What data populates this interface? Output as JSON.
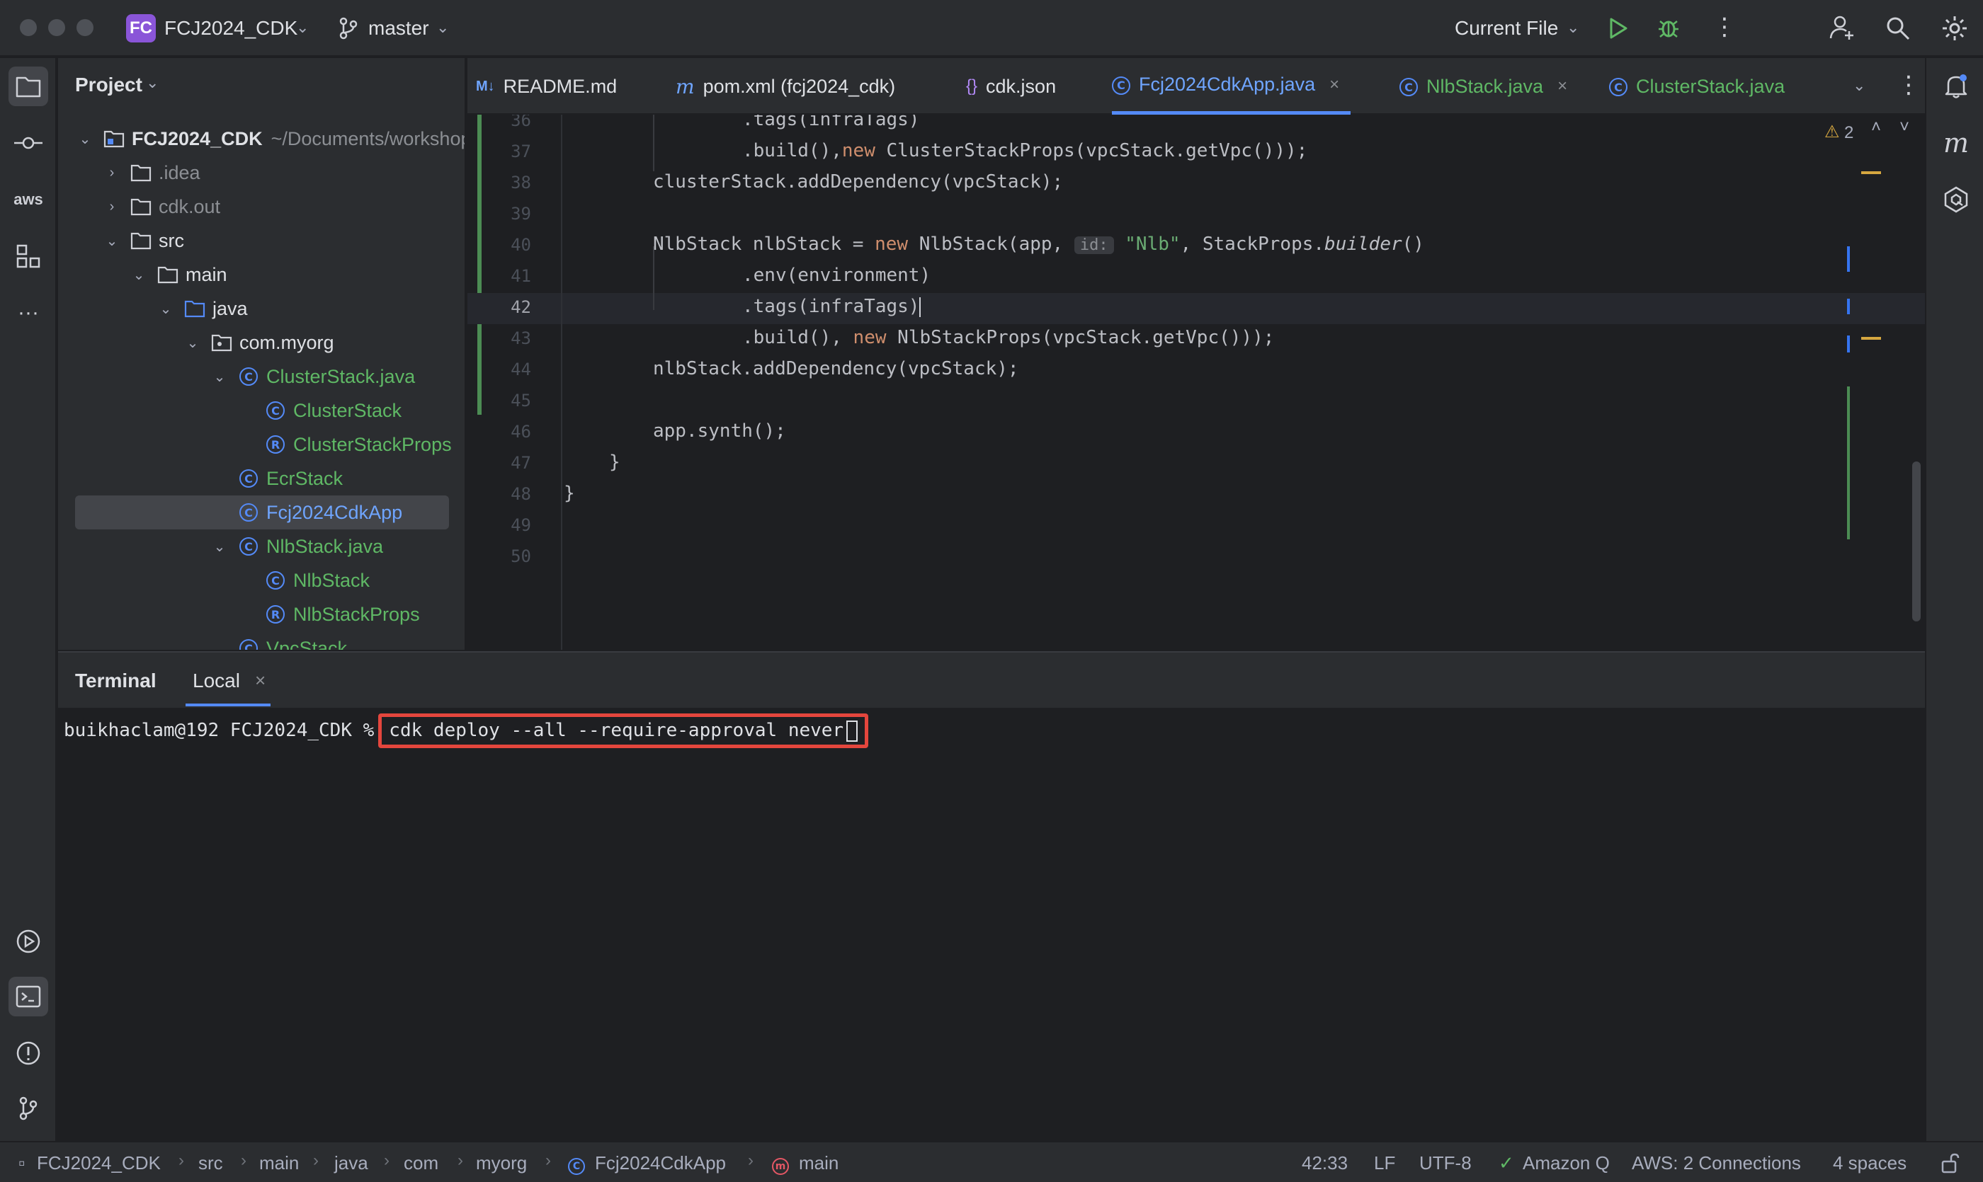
{
  "titlebar": {
    "project_badge": "FC",
    "project_name": "FCJ2024_CDK",
    "branch": "master",
    "run_config": "Current File"
  },
  "project_panel": {
    "title": "Project",
    "tree": [
      {
        "label": "FCJ2024_CDK",
        "suffix": "~/Documents/workshop"
      },
      {
        "label": ".idea"
      },
      {
        "label": "cdk.out"
      },
      {
        "label": "src"
      },
      {
        "label": "main"
      },
      {
        "label": "java"
      },
      {
        "label": "com.myorg"
      },
      {
        "label": "ClusterStack.java"
      },
      {
        "label": "ClusterStack"
      },
      {
        "label": "ClusterStackProps"
      },
      {
        "label": "EcrStack"
      },
      {
        "label": "Fcj2024CdkApp"
      },
      {
        "label": "NlbStack.java"
      },
      {
        "label": "NlbStack"
      },
      {
        "label": "NlbStackProps"
      },
      {
        "label": "VpcStack"
      }
    ]
  },
  "tabs": [
    {
      "label": "README.md",
      "icon": "M↓"
    },
    {
      "label": "pom.xml (fcj2024_cdk)",
      "icon": "m"
    },
    {
      "label": "cdk.json",
      "icon": "{}"
    },
    {
      "label": "Fcj2024CdkApp.java",
      "icon": "C",
      "active": true
    },
    {
      "label": "NlbStack.java",
      "icon": "C"
    },
    {
      "label": "ClusterStack.java",
      "icon": "C"
    }
  ],
  "editor": {
    "warning_count": "2",
    "line_numbers": [
      "36",
      "37",
      "38",
      "39",
      "40",
      "41",
      "42",
      "43",
      "44",
      "45",
      "46",
      "47",
      "48",
      "49",
      "50"
    ],
    "lines": {
      "l36": ".tags(infraTags)",
      "l37a": ".build(),",
      "l37b": "new",
      "l37c": " ClusterStackProps(vpcStack.getVpc()));",
      "l38": "clusterStack.addDependency(vpcStack);",
      "l40a": "NlbStack nlbStack = ",
      "l40b": "new",
      "l40c": " NlbStack(app, ",
      "l40hint": "id:",
      "l40str": "\"Nlb\"",
      "l40d": ", StackProps.",
      "l40e": "builder",
      "l40f": "()",
      "l41": ".env(environment)",
      "l42": ".tags(infraTags)",
      "l43a": ".build(), ",
      "l43b": "new",
      "l43c": " NlbStackProps(vpcStack.getVpc()));",
      "l44": "nlbStack.addDependency(vpcStack);",
      "l46": "app.synth();",
      "l47": "}",
      "l48": "}"
    }
  },
  "terminal": {
    "title": "Terminal",
    "tab": "Local",
    "prompt": "buikhaclam@192 FCJ2024_CDK %",
    "command": "cdk deploy --all --require-approval never"
  },
  "statusbar": {
    "breadcrumb": [
      "FCJ2024_CDK",
      "src",
      "main",
      "java",
      "com",
      "myorg",
      "Fcj2024CdkApp",
      "main"
    ],
    "position": "42:33",
    "line_ending": "LF",
    "encoding": "UTF-8",
    "amazon_q": "Amazon Q",
    "aws": "AWS: 2 Connections",
    "indent": "4 spaces"
  },
  "colors": {
    "accent": "#548af7",
    "highlight_box": "#e4463d",
    "project_badge": "#8a55d8"
  }
}
